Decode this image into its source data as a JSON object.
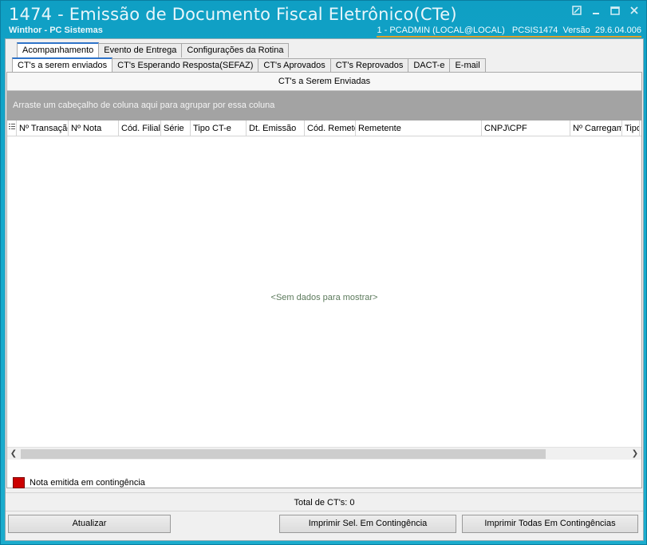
{
  "window": {
    "title": "1474 - Emissão de Documento Fiscal Eletrônico(CTe)",
    "subtitle": "Winthor - PC Sistemas",
    "sysinfo": "1 - PCADMIN (LOCAL@LOCAL)   PCSIS1474  Versão  29.6.04.006",
    "controls": [
      "restore-icon",
      "minimize-icon",
      "maximize-icon",
      "close-icon"
    ]
  },
  "tabs_main": [
    {
      "label": "Acompanhamento",
      "active": true
    },
    {
      "label": "Evento de Entrega",
      "active": false
    },
    {
      "label": "Configurações da Rotina",
      "active": false
    }
  ],
  "tabs_sub": [
    {
      "label": "CT's a serem enviados",
      "active": true
    },
    {
      "label": "CT's Esperando Resposta(SEFAZ)",
      "active": false
    },
    {
      "label": "CT's Aprovados",
      "active": false
    },
    {
      "label": "CT's Reprovados",
      "active": false
    },
    {
      "label": "DACT-e",
      "active": false
    },
    {
      "label": "E-mail",
      "active": false
    }
  ],
  "panel": {
    "title": "CT's a Serem Enviadas",
    "group_hint": "Arraste um cabeçalho de coluna aqui para agrupar por essa coluna",
    "columns": [
      "Nº Transação",
      "Nº Nota",
      "Cód. Filial",
      "Série",
      "Tipo CT-e",
      "Dt. Emissão",
      "Cód. Remetente",
      "Remetente",
      "CNPJ\\CPF",
      "Nº Carregamento",
      "Tipo D"
    ],
    "empty_message": "<Sem dados para mostrar>"
  },
  "legend": {
    "label": "Nota emitida em contingência",
    "color": "#cc0000"
  },
  "total": "Total de CT's: 0",
  "buttons": {
    "refresh": "Atualizar",
    "print_selected": "Imprimir Sel. Em Contingência",
    "print_all": "Imprimir Todas  Em Contingências"
  }
}
